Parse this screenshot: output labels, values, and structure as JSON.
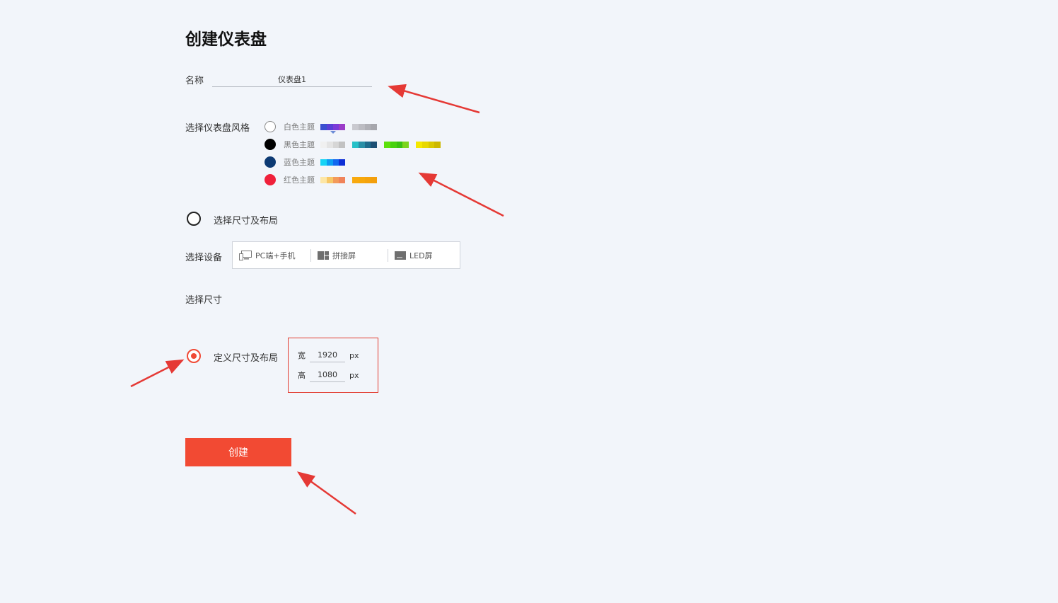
{
  "page": {
    "title": "创建仪表盘"
  },
  "name_field": {
    "label": "名称",
    "value": "仪表盘1"
  },
  "style_section": {
    "label": "选择仪表盘风格",
    "themes": [
      {
        "name": "白色主题",
        "radio_color": "",
        "selected": false,
        "palettes": [
          [
            "#3b4fd0",
            "#5a3fd6",
            "#7b3ad8",
            "#9b3cc8"
          ],
          [
            "#c9c9cf",
            "#bcbcc2",
            "#b0b0b6",
            "#a6a6ac"
          ]
        ]
      },
      {
        "name": "黑色主题",
        "radio_color": "#000000",
        "selected": false,
        "palettes": [
          [
            "#f0f0f0",
            "#e4e4e4",
            "#d6d6d6",
            "#c2c2c2"
          ],
          [
            "#27c1c8",
            "#2a8fa6",
            "#1f6c8c",
            "#1d4f74"
          ],
          [
            "#5de00c",
            "#46d10d",
            "#39c110",
            "#7bd41c"
          ],
          [
            "#f5e800",
            "#e8d800",
            "#d9c800",
            "#cdb800"
          ]
        ]
      },
      {
        "name": "蓝色主题",
        "radio_color": "#0d3a73",
        "selected": false,
        "palettes": [
          [
            "#15d3f5",
            "#0c9cf2",
            "#1067ef",
            "#0e2fd6"
          ]
        ]
      },
      {
        "name": "红色主题",
        "radio_color": "#f0203a",
        "selected": false,
        "palettes": [
          [
            "#fde6a5",
            "#f7c766",
            "#f39a5a",
            "#f0835a"
          ],
          [
            "#f8a90e",
            "#f7a80b",
            "#f5a30c",
            "#f39f0c"
          ]
        ]
      }
    ]
  },
  "layout_option": {
    "label": "选择尺寸及布局",
    "selected": false
  },
  "device_section": {
    "label": "选择设备",
    "devices": [
      {
        "label": "PC端+手机",
        "icon": "pc-phone-icon"
      },
      {
        "label": "拼接屏",
        "icon": "splice-screen-icon"
      },
      {
        "label": "LED屏",
        "icon": "led-screen-icon"
      }
    ]
  },
  "size_section": {
    "label": "选择尺寸"
  },
  "custom_option": {
    "label": "定义尺寸及布局",
    "selected": true,
    "width_label": "宽",
    "width_value": "1920",
    "height_label": "高",
    "height_value": "1080",
    "unit": "px"
  },
  "create_button": {
    "label": "创建"
  },
  "colors": {
    "accent": "#f24a33",
    "annotation_arrow": "#e53935",
    "background": "#f2f5fa"
  }
}
